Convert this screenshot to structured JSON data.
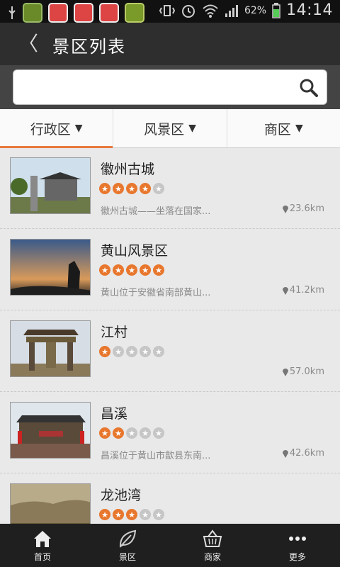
{
  "status_bar": {
    "battery": "62%",
    "time": "14:14"
  },
  "header": {
    "back_symbol": "〈",
    "title": "景区列表"
  },
  "search": {
    "value": "",
    "placeholder": ""
  },
  "tabs": [
    {
      "label": "行政区"
    },
    {
      "label": "风景区"
    },
    {
      "label": "商区"
    }
  ],
  "items": [
    {
      "name": "徽州古城",
      "rating": 4,
      "desc": "徽州古城——坐落在国家...",
      "distance": "23.6km"
    },
    {
      "name": "黄山风景区",
      "rating": 5,
      "desc": "黄山位于安徽省南部黄山...",
      "distance": "41.2km"
    },
    {
      "name": "江村",
      "rating": 1,
      "desc": "",
      "distance": "57.0km"
    },
    {
      "name": "昌溪",
      "rating": 2,
      "desc": "昌溪位于黄山市歙县东南...",
      "distance": "42.6km"
    },
    {
      "name": "龙池湾",
      "rating": 3,
      "desc": "",
      "distance": ""
    }
  ],
  "bottom_nav": [
    {
      "label": "首页",
      "icon": "home-icon"
    },
    {
      "label": "景区",
      "icon": "leaf-icon"
    },
    {
      "label": "商家",
      "icon": "basket-icon"
    },
    {
      "label": "更多",
      "icon": "more-icon"
    }
  ],
  "colors": {
    "accent": "#e8772e",
    "titlebar": "#2e2e2e",
    "bottom_nav": "#1f1f1f"
  }
}
